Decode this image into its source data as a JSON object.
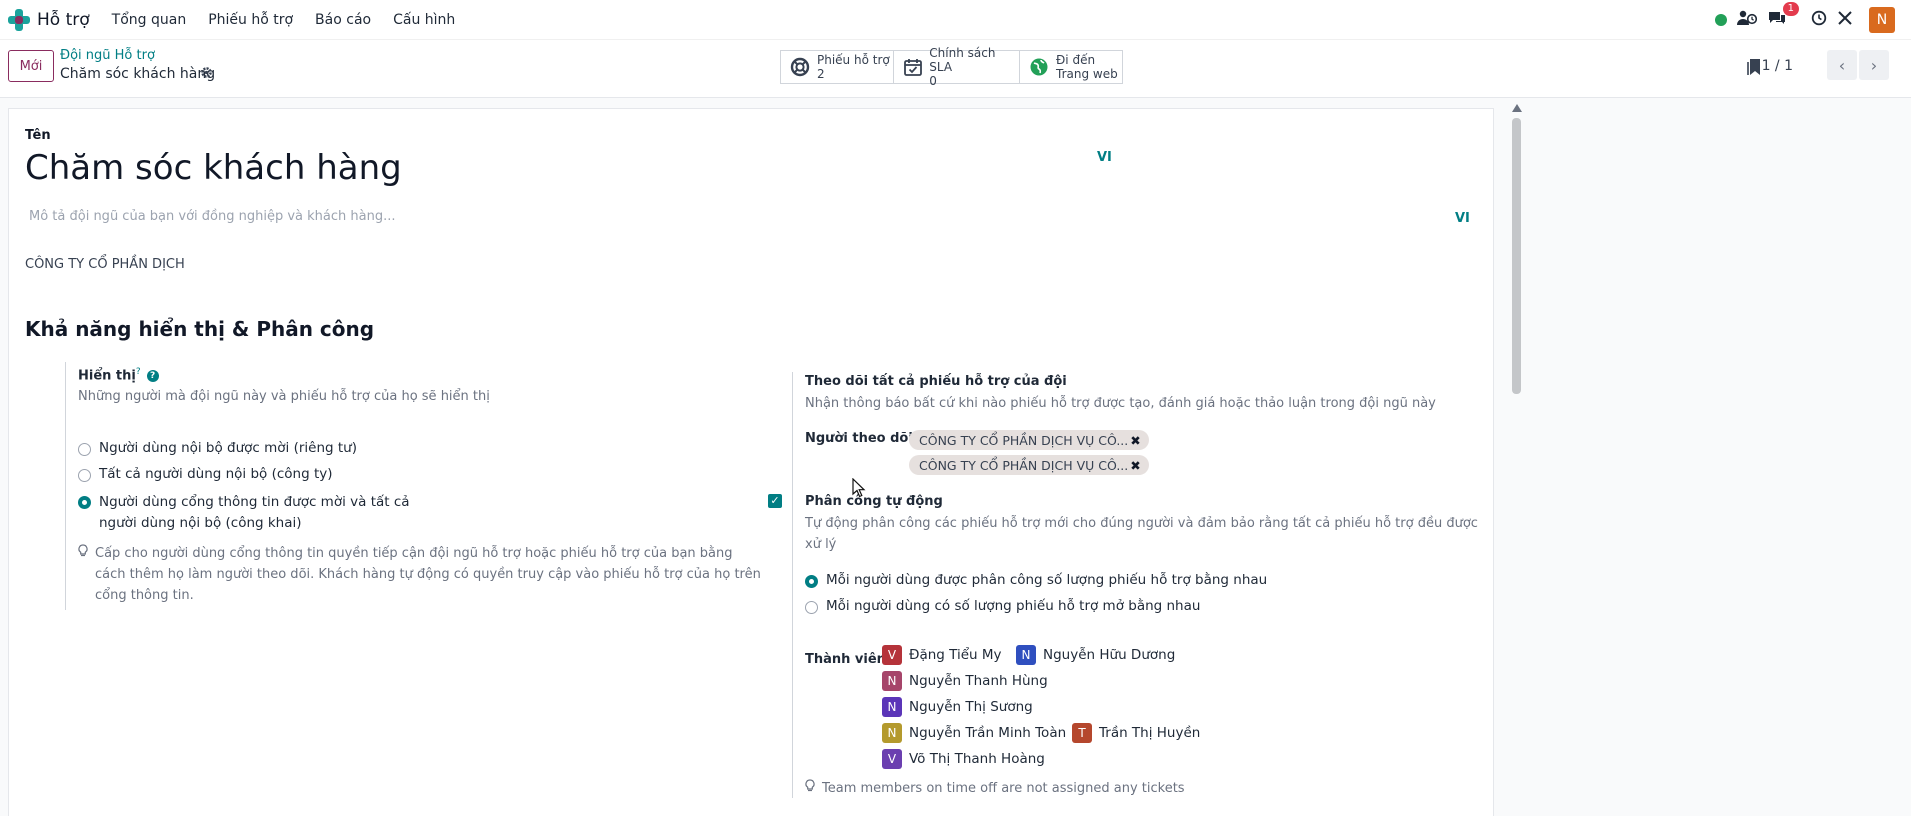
{
  "navbar": {
    "app_name": "Hỗ trợ",
    "menu": [
      "Tổng quan",
      "Phiếu hỗ trợ",
      "Báo cáo",
      "Cấu hình"
    ],
    "chat_badge": "1",
    "user_initial": "N"
  },
  "control_panel": {
    "new_button": "Mới",
    "breadcrumb_parent": "Đội ngũ Hỗ trợ",
    "breadcrumb_current": "Chăm sóc khách hàng",
    "smart_buttons": [
      {
        "line1": "Phiếu hỗ trợ",
        "line2": "2"
      },
      {
        "line1": "Chính sách SLA",
        "line2": "0"
      },
      {
        "line1": "Đi đến",
        "line2": "Trang web"
      }
    ],
    "pager": "1 / 1"
  },
  "form": {
    "name_label": "Tên",
    "name_value": "Chăm sóc khách hàng",
    "lang_badge": "VI",
    "description_placeholder": "Mô tả đội ngũ của bạn với đồng nghiệp và khách hàng...",
    "company": "CÔNG TY CỔ PHẦN DỊCH",
    "section_title": "Khả năng hiển thị & Phân công",
    "visibility": {
      "label": "Hiển thị",
      "help_mark": "?",
      "description": "Những người mà đội ngũ này và phiếu hỗ trợ của họ sẽ hiển thị",
      "options": [
        {
          "line1": "Người dùng nội bộ được mời (riêng tư)",
          "line2": "",
          "selected": false
        },
        {
          "line1": "Tất cả người dùng nội bộ (công ty)",
          "line2": "",
          "selected": false
        },
        {
          "line1": "Người dùng cổng thông tin được mời và tất cả",
          "line2": "người dùng nội bộ (công khai)",
          "selected": true
        }
      ],
      "tip_lines": [
        "Cấp cho người dùng cổng thông tin quyền tiếp cận đội ngũ hỗ trợ hoặc phiếu hỗ trợ của bạn bằng",
        "cách thêm họ làm người theo dõi. Khách hàng tự động có quyền truy cập vào phiếu hỗ trợ của họ trên",
        "cổng thông tin."
      ]
    },
    "follow": {
      "label": "Theo dõi tất cả phiếu hỗ trợ của đội",
      "description": "Nhận thông báo bất cứ khi nào phiếu hỗ trợ được tạo, đánh giá hoặc thảo luận trong đội ngũ này",
      "followers_label": "Người theo dõi",
      "followers": [
        "CÔNG TY CỔ PHẦN DỊCH VỤ CÔ...",
        "CÔNG TY CỔ PHẦN DỊCH VỤ CÔ..."
      ]
    },
    "auto_assign": {
      "label": "Phân công tự động",
      "checked": true,
      "description_line1": "Tự động phân công các phiếu hỗ trợ mới cho đúng người và đảm bảo rằng tất cả phiếu hỗ trợ đều được",
      "description_line2": "xử lý",
      "options": [
        {
          "text": "Mỗi người dùng được phân công số lượng phiếu hỗ trợ bằng nhau",
          "selected": true
        },
        {
          "text": "Mỗi người dùng có số lượng phiếu hỗ trợ mở bằng nhau",
          "selected": false
        }
      ]
    },
    "members": {
      "label": "Thành viên",
      "list": [
        {
          "initial": "V",
          "name": "Đặng Tiểu My",
          "color": "#b5333a"
        },
        {
          "initial": "N",
          "name": "Nguyễn Hữu Dương",
          "color": "#2f4fbf"
        },
        {
          "initial": "N",
          "name": "Nguyễn Thanh Hùng",
          "color": "#a6456a"
        },
        {
          "initial": "N",
          "name": "Nguyễn Thị Sương",
          "color": "#5b35b8"
        },
        {
          "initial": "N",
          "name": "Nguyễn Trần Minh Toàn",
          "color": "#b49a2d"
        },
        {
          "initial": "T",
          "name": "Trần Thị Huyền",
          "color": "#b5472d"
        },
        {
          "initial": "V",
          "name": "Võ Thị Thanh Hoàng",
          "color": "#6b3fb0"
        }
      ],
      "tip": "Team members on time off are not assigned any tickets"
    }
  },
  "colors": {
    "brand": "#8a2c5f",
    "accent": "#017e84",
    "status_online": "#22a058",
    "user_avatar": "#d96a1e"
  }
}
